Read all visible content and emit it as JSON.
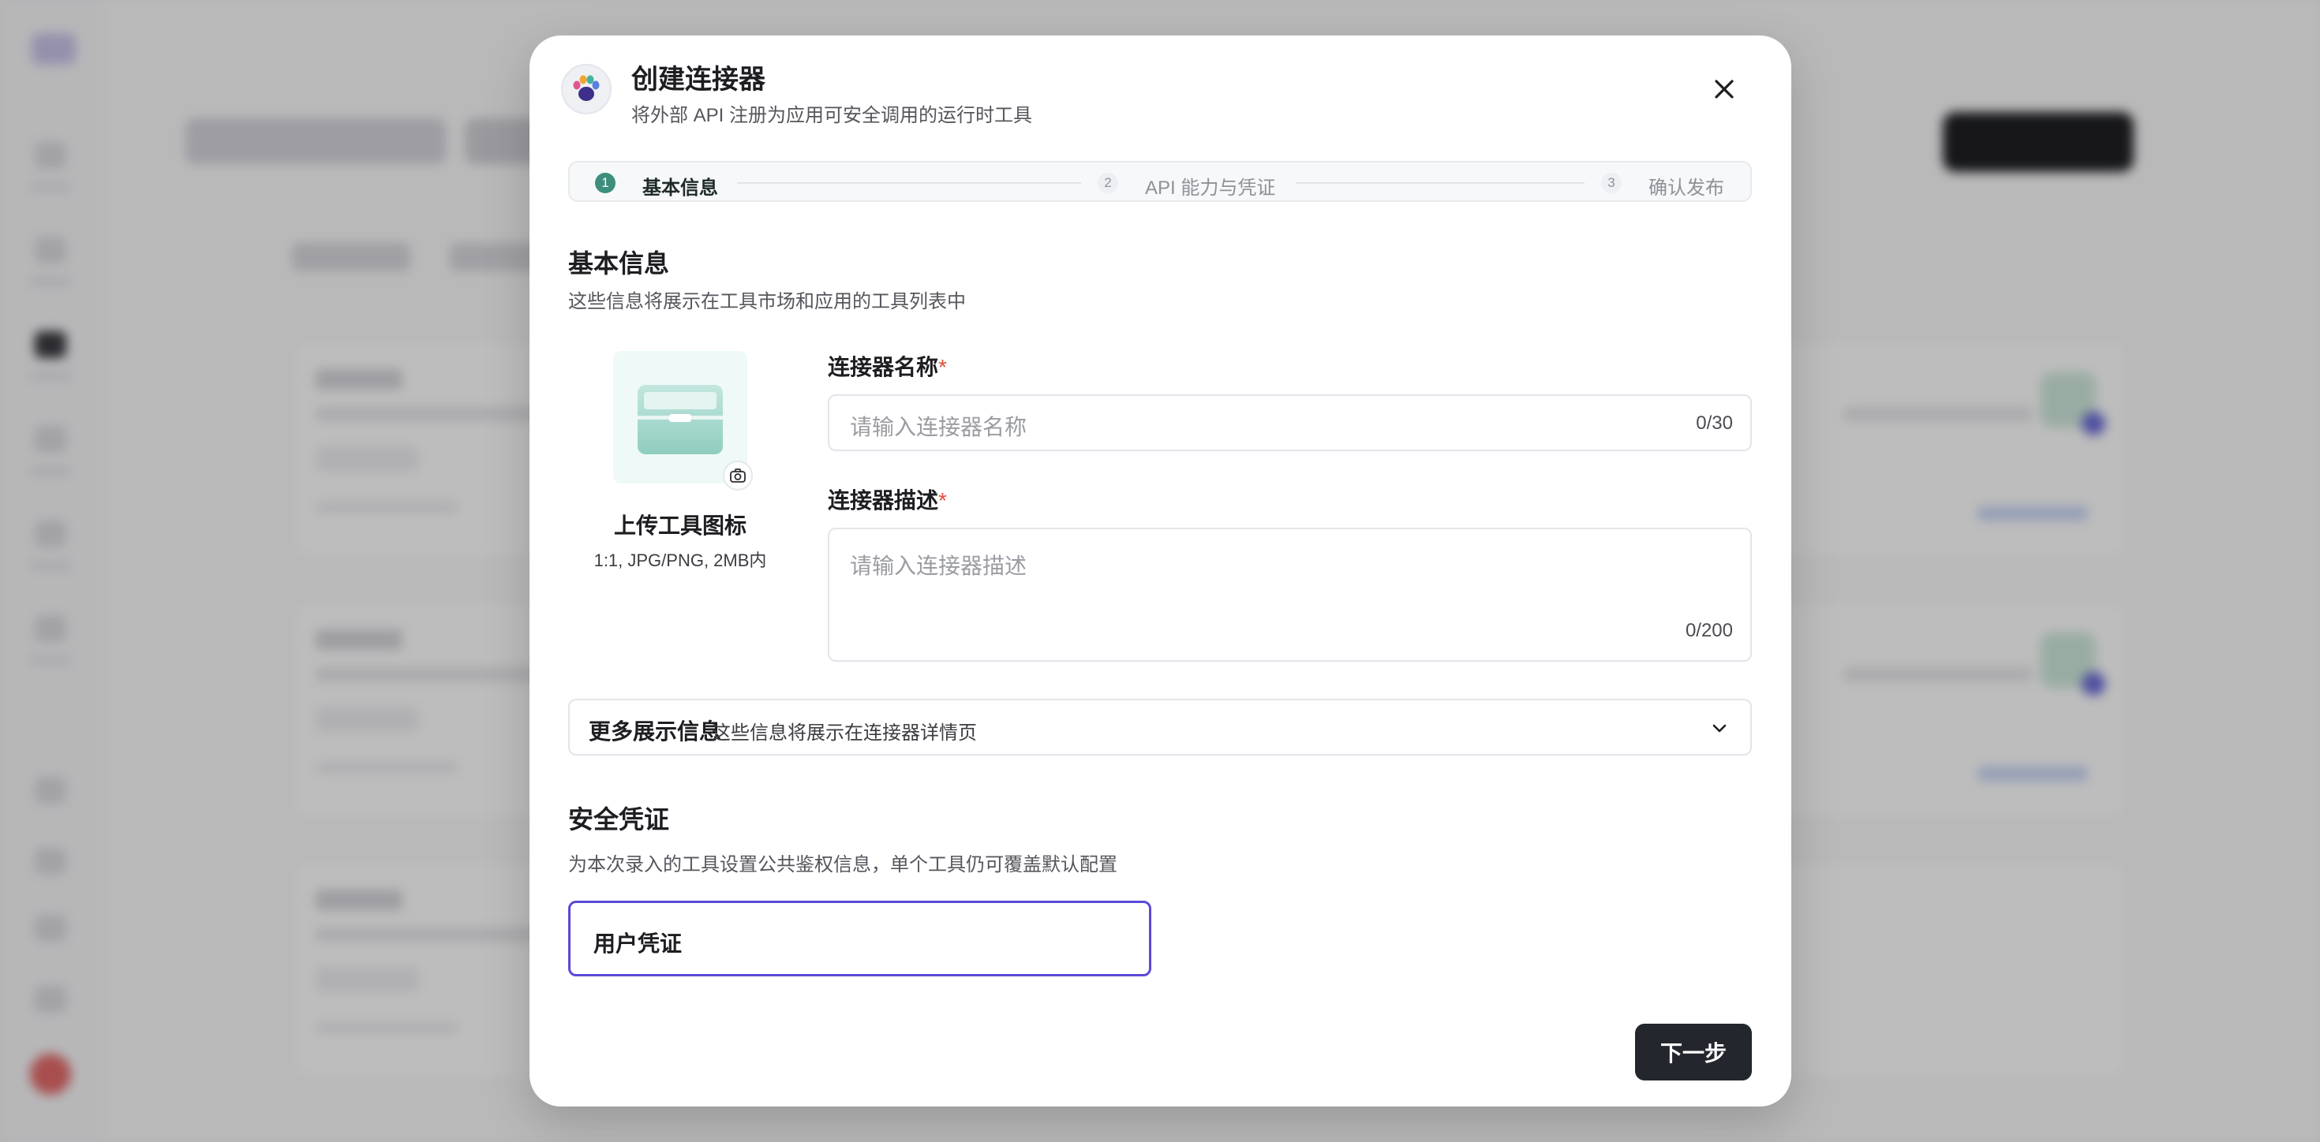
{
  "modal": {
    "title": "创建连接器",
    "subtitle": "将外部 API 注册为应用可安全调用的运行时工具"
  },
  "steps": [
    {
      "num": "1",
      "label": "基本信息",
      "active": true
    },
    {
      "num": "2",
      "label": "API 能力与凭证",
      "active": false
    },
    {
      "num": "3",
      "label": "确认发布",
      "active": false
    }
  ],
  "basic": {
    "title": "基本信息",
    "desc": "这些信息将展示在工具市场和应用的工具列表中"
  },
  "upload": {
    "title": "上传工具图标",
    "hint": "1:1, JPG/PNG, 2MB内"
  },
  "fields": {
    "name": {
      "label": "连接器名称",
      "required_mark": "*",
      "placeholder": "请输入连接器名称",
      "counter": "0/30"
    },
    "description": {
      "label": "连接器描述",
      "required_mark": "*",
      "placeholder": "请输入连接器描述",
      "counter": "0/200"
    }
  },
  "more_info": {
    "title": "更多展示信息",
    "desc": "这些信息将展示在连接器详情页"
  },
  "security": {
    "title": "安全凭证",
    "desc": "为本次录入的工具设置公共鉴权信息，单个工具仍可覆盖默认配置",
    "credential_label": "用户凭证"
  },
  "actions": {
    "next_label": "下一步"
  },
  "colors": {
    "accent_step": "#3d8e7c",
    "credential_border": "#5b4ad6",
    "primary_button": "#23262d",
    "required": "#e34d3b"
  },
  "icons": [
    "paw-logo-icon",
    "close-icon",
    "toolbox-icon",
    "camera-icon",
    "chevron-down-icon"
  ]
}
